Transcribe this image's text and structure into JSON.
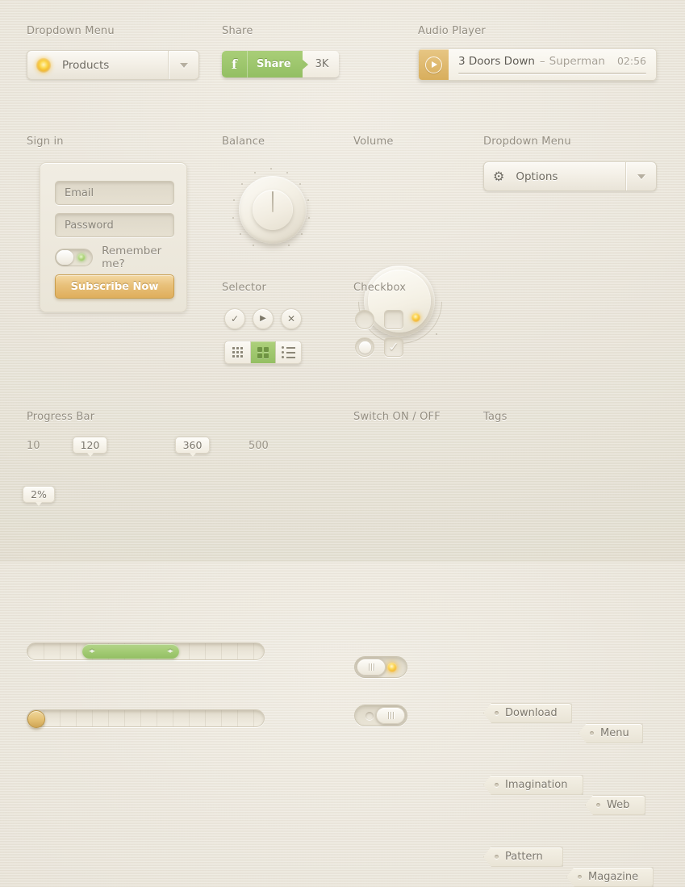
{
  "sections": {
    "dropdown_menu_1": "Dropdown Menu",
    "share": "Share",
    "audio_player": "Audio Player",
    "sign_in": "Sign in",
    "balance": "Balance",
    "volume": "Volume",
    "dropdown_menu_2": "Dropdown Menu",
    "selector": "Selector",
    "checkbox": "Checkbox",
    "progress_bar": "Progress Bar",
    "switch": "Switch ON / OFF",
    "tags": "Tags"
  },
  "dropdown_products": {
    "value": "Products",
    "icon": "orb-icon",
    "arrow": "chevron-down-icon"
  },
  "dropdown_options": {
    "value": "Options",
    "icon": "gear-icon",
    "arrow": "chevron-down-icon"
  },
  "share_button": {
    "facebook_glyph": "f",
    "label": "Share",
    "count": "3K",
    "accent": "#93bf63"
  },
  "audio_player": {
    "play_icon": "play-icon",
    "artist": "3 Doors Down",
    "separator": "–",
    "title": "Superman",
    "time": "02:56",
    "accent": "#d8ae5c"
  },
  "sign_in_form": {
    "email_placeholder": "Email",
    "email_value": "",
    "password_placeholder": "Password",
    "password_value": "",
    "remember_label": "Remember me?",
    "remember_state": "off",
    "submit_label": "Subscribe Now",
    "submit_color": "#e3be77"
  },
  "balance_knob": {
    "position": "center",
    "value_angle": 0
  },
  "volume_knob": {
    "indicator": "dot",
    "value_angle": 135,
    "dot_color": "#f3b928"
  },
  "selector_buttons": [
    {
      "name": "check",
      "glyph": "✓"
    },
    {
      "name": "play",
      "glyph": "▶"
    },
    {
      "name": "close",
      "glyph": "✕"
    }
  ],
  "view_switcher": {
    "items": [
      {
        "name": "grid-small",
        "active": false
      },
      {
        "name": "grid-large",
        "active": true
      },
      {
        "name": "list",
        "active": false
      }
    ],
    "active_color": "#94bf63"
  },
  "checkbox_group": {
    "radio_unchecked": "off",
    "checkbox_unchecked": "off",
    "radio_checked": "on",
    "checkbox_checked_glyph": "✓"
  },
  "progress_bars": {
    "range": {
      "min_label": "10",
      "max_label": "500",
      "start_label": "120",
      "end_label": "360",
      "fill_color": "#9fc870",
      "start_pct": 24,
      "end_pct": 78
    },
    "single": {
      "label": "2%",
      "value_pct": 2,
      "handle_color": "#dcb468"
    }
  },
  "switches": [
    {
      "state": "ON",
      "lamp": "#f5b928"
    },
    {
      "state": "OFF",
      "lamp": "#ddd7c8"
    }
  ],
  "tags": [
    "Download",
    "Menu",
    "Imagination",
    "Web",
    "Pattern",
    "Magazine"
  ],
  "colors": {
    "background": "#ebe7dd",
    "label": "#948e81",
    "text": "#6e6a60",
    "green": "#93bf63",
    "gold": "#e3be77"
  }
}
